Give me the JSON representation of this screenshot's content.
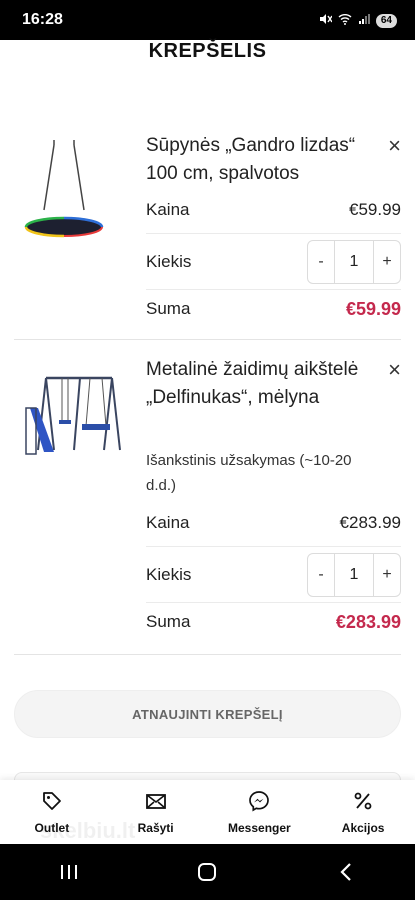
{
  "status_bar": {
    "time": "16:28",
    "battery": "64"
  },
  "page": {
    "title": "KREPŠELIS"
  },
  "cart": {
    "items": [
      {
        "name": "Sūpynės „Gandro lizdas“ 100 cm, spalvotos",
        "note": "",
        "price_label": "Kaina",
        "price": "€59.99",
        "qty_label": "Kiekis",
        "qty": "1",
        "minus": "-",
        "plus": "+",
        "sum_label": "Suma",
        "sum": "€59.99",
        "remove": "×"
      },
      {
        "name": "Metalinė žaidimų aikštelė „Delfinukas“, mėlyna",
        "note": "Išankstinis užsakymas (~10-20 d.d.)",
        "price_label": "Kaina",
        "price": "€283.99",
        "qty_label": "Kiekis",
        "qty": "1",
        "minus": "-",
        "plus": "+",
        "sum_label": "Suma",
        "sum": "€283.99",
        "remove": "×"
      }
    ],
    "update_button": "ATNAUJINTI KREPŠELĮ"
  },
  "bottom_nav": [
    {
      "label": "Outlet",
      "icon": "tag-icon"
    },
    {
      "label": "Rašyti",
      "icon": "envelope-icon"
    },
    {
      "label": "Messenger",
      "icon": "messenger-icon"
    },
    {
      "label": "Akcijos",
      "icon": "percent-icon"
    }
  ],
  "watermark": "skelbiu.lt",
  "colors": {
    "sum": "#c4294d",
    "status_bar": "#000000"
  }
}
